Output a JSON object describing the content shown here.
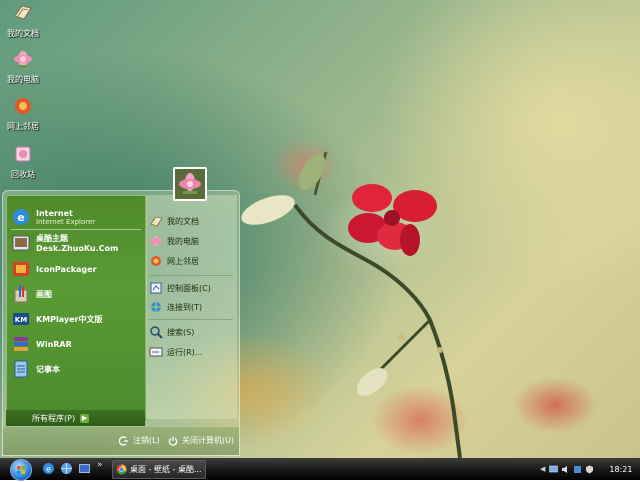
{
  "desktop_icons": [
    {
      "label": "我的文档",
      "icon": "my-documents-icon"
    },
    {
      "label": "我的电脑",
      "icon": "my-computer-icon"
    },
    {
      "label": "网上邻居",
      "icon": "network-places-icon"
    },
    {
      "label": "回收站",
      "icon": "recycle-bin-icon"
    }
  ],
  "start_menu": {
    "pinned": [
      {
        "label": "Internet",
        "sublabel": "Internet Explorer",
        "icon": "internet-explorer-icon"
      },
      {
        "label": "桌酷主题Desk.ZhuoKu.Com",
        "icon": "zhuoku-icon"
      },
      {
        "label": "IconPackager",
        "icon": "iconpackager-icon"
      },
      {
        "label": "画图",
        "icon": "paint-icon"
      },
      {
        "label": "KMPlayer中文版",
        "icon": "kmplayer-icon"
      },
      {
        "label": "WinRAR",
        "icon": "winrar-icon"
      },
      {
        "label": "记事本",
        "icon": "notepad-icon"
      }
    ],
    "all_programs": "所有程序(P)",
    "right_items": [
      {
        "label": "我的文档",
        "icon": "my-documents-icon"
      },
      {
        "label": "我的电脑",
        "icon": "my-computer-icon"
      },
      {
        "label": "网上邻居",
        "icon": "network-places-icon"
      },
      {
        "label": "控制面板(C)",
        "icon": "control-panel-icon"
      },
      {
        "label": "连接到(T)",
        "icon": "connect-to-icon"
      },
      {
        "label": "搜索(S)",
        "icon": "search-icon"
      },
      {
        "label": "运行(R)...",
        "icon": "run-icon"
      }
    ],
    "logoff": "注销(L)",
    "shutdown": "关闭计算机(U)"
  },
  "taskbar": {
    "task_button": "桌面 - 壁纸 - 桌酷...",
    "overflow": "»",
    "clock": "18:21"
  },
  "colors": {
    "start_left_green": "#4f8a2a",
    "taskbar_dark": "#1a1a1a"
  }
}
